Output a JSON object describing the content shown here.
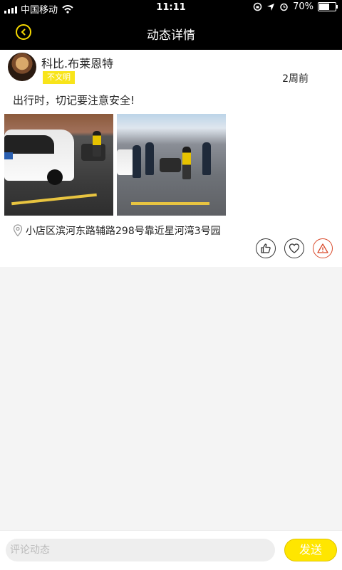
{
  "status_bar": {
    "carrier": "中国移动",
    "time": "11:11",
    "battery_text": "70%",
    "battery_level": 0.7
  },
  "nav": {
    "title": "动态详情",
    "back_icon": "chevron-left-icon"
  },
  "post": {
    "author": "科比.布莱恩特",
    "tag": "不文明",
    "time": "2周前",
    "text": "出行时，切记要注意安全!",
    "location": "小店区滨河东路辅路298号靠近星河湾3号园",
    "actions": [
      "thumbs-up-icon",
      "heart-icon",
      "warning-icon"
    ]
  },
  "comment": {
    "placeholder": "评论动态",
    "send_label": "发送"
  },
  "colors": {
    "accent_yellow": "#f8e41a",
    "report_red": "#d94a2b",
    "header_bg": "#000000"
  }
}
